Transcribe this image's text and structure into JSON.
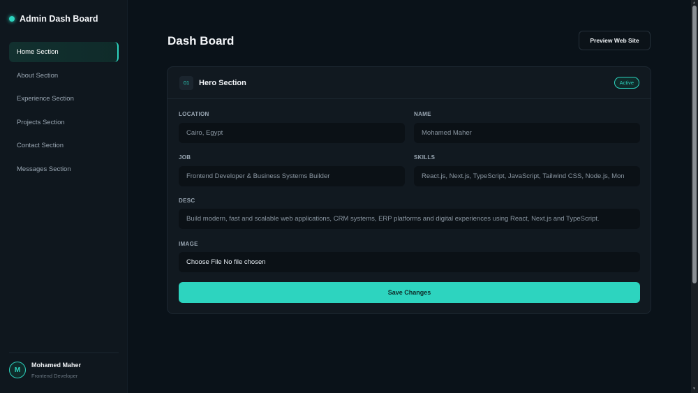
{
  "brand": {
    "title": "Admin Dash Board"
  },
  "sidebar": {
    "items": [
      {
        "label": "Home Section"
      },
      {
        "label": "About Section"
      },
      {
        "label": "Experience Section"
      },
      {
        "label": "Projects Section"
      },
      {
        "label": "Contact Section"
      },
      {
        "label": "Messages Section"
      }
    ],
    "user": {
      "initial": "M",
      "name": "Mohamed Maher",
      "role": "Frontend Developer"
    }
  },
  "header": {
    "title": "Dash Board",
    "preview_label": "Preview Web Site"
  },
  "card": {
    "number": "01",
    "title": "Hero Section",
    "status": "Active",
    "fields": {
      "location": {
        "label": "LOCATION",
        "value": "Cairo, Egypt"
      },
      "name": {
        "label": "NAME",
        "value": "Mohamed Maher"
      },
      "job": {
        "label": "JOB",
        "value": "Frontend Developer & Business Systems Builder"
      },
      "skills": {
        "label": "SKILLS",
        "value": "React.js, Next.js, TypeScript, JavaScript, Tailwind CSS, Node.js, Mon"
      },
      "desc": {
        "label": "DESC",
        "value": "Build modern, fast and scalable web applications, CRM systems, ERP platforms and digital experiences using React, Next.js and TypeScript."
      },
      "image": {
        "label": "IMAGE",
        "value": "Choose File No file chosen"
      }
    },
    "save_label": "Save Changes"
  },
  "colors": {
    "accent": "#2dd4bf",
    "background": "#0a1219",
    "sidebar": "#0f171e",
    "card": "#111920"
  }
}
